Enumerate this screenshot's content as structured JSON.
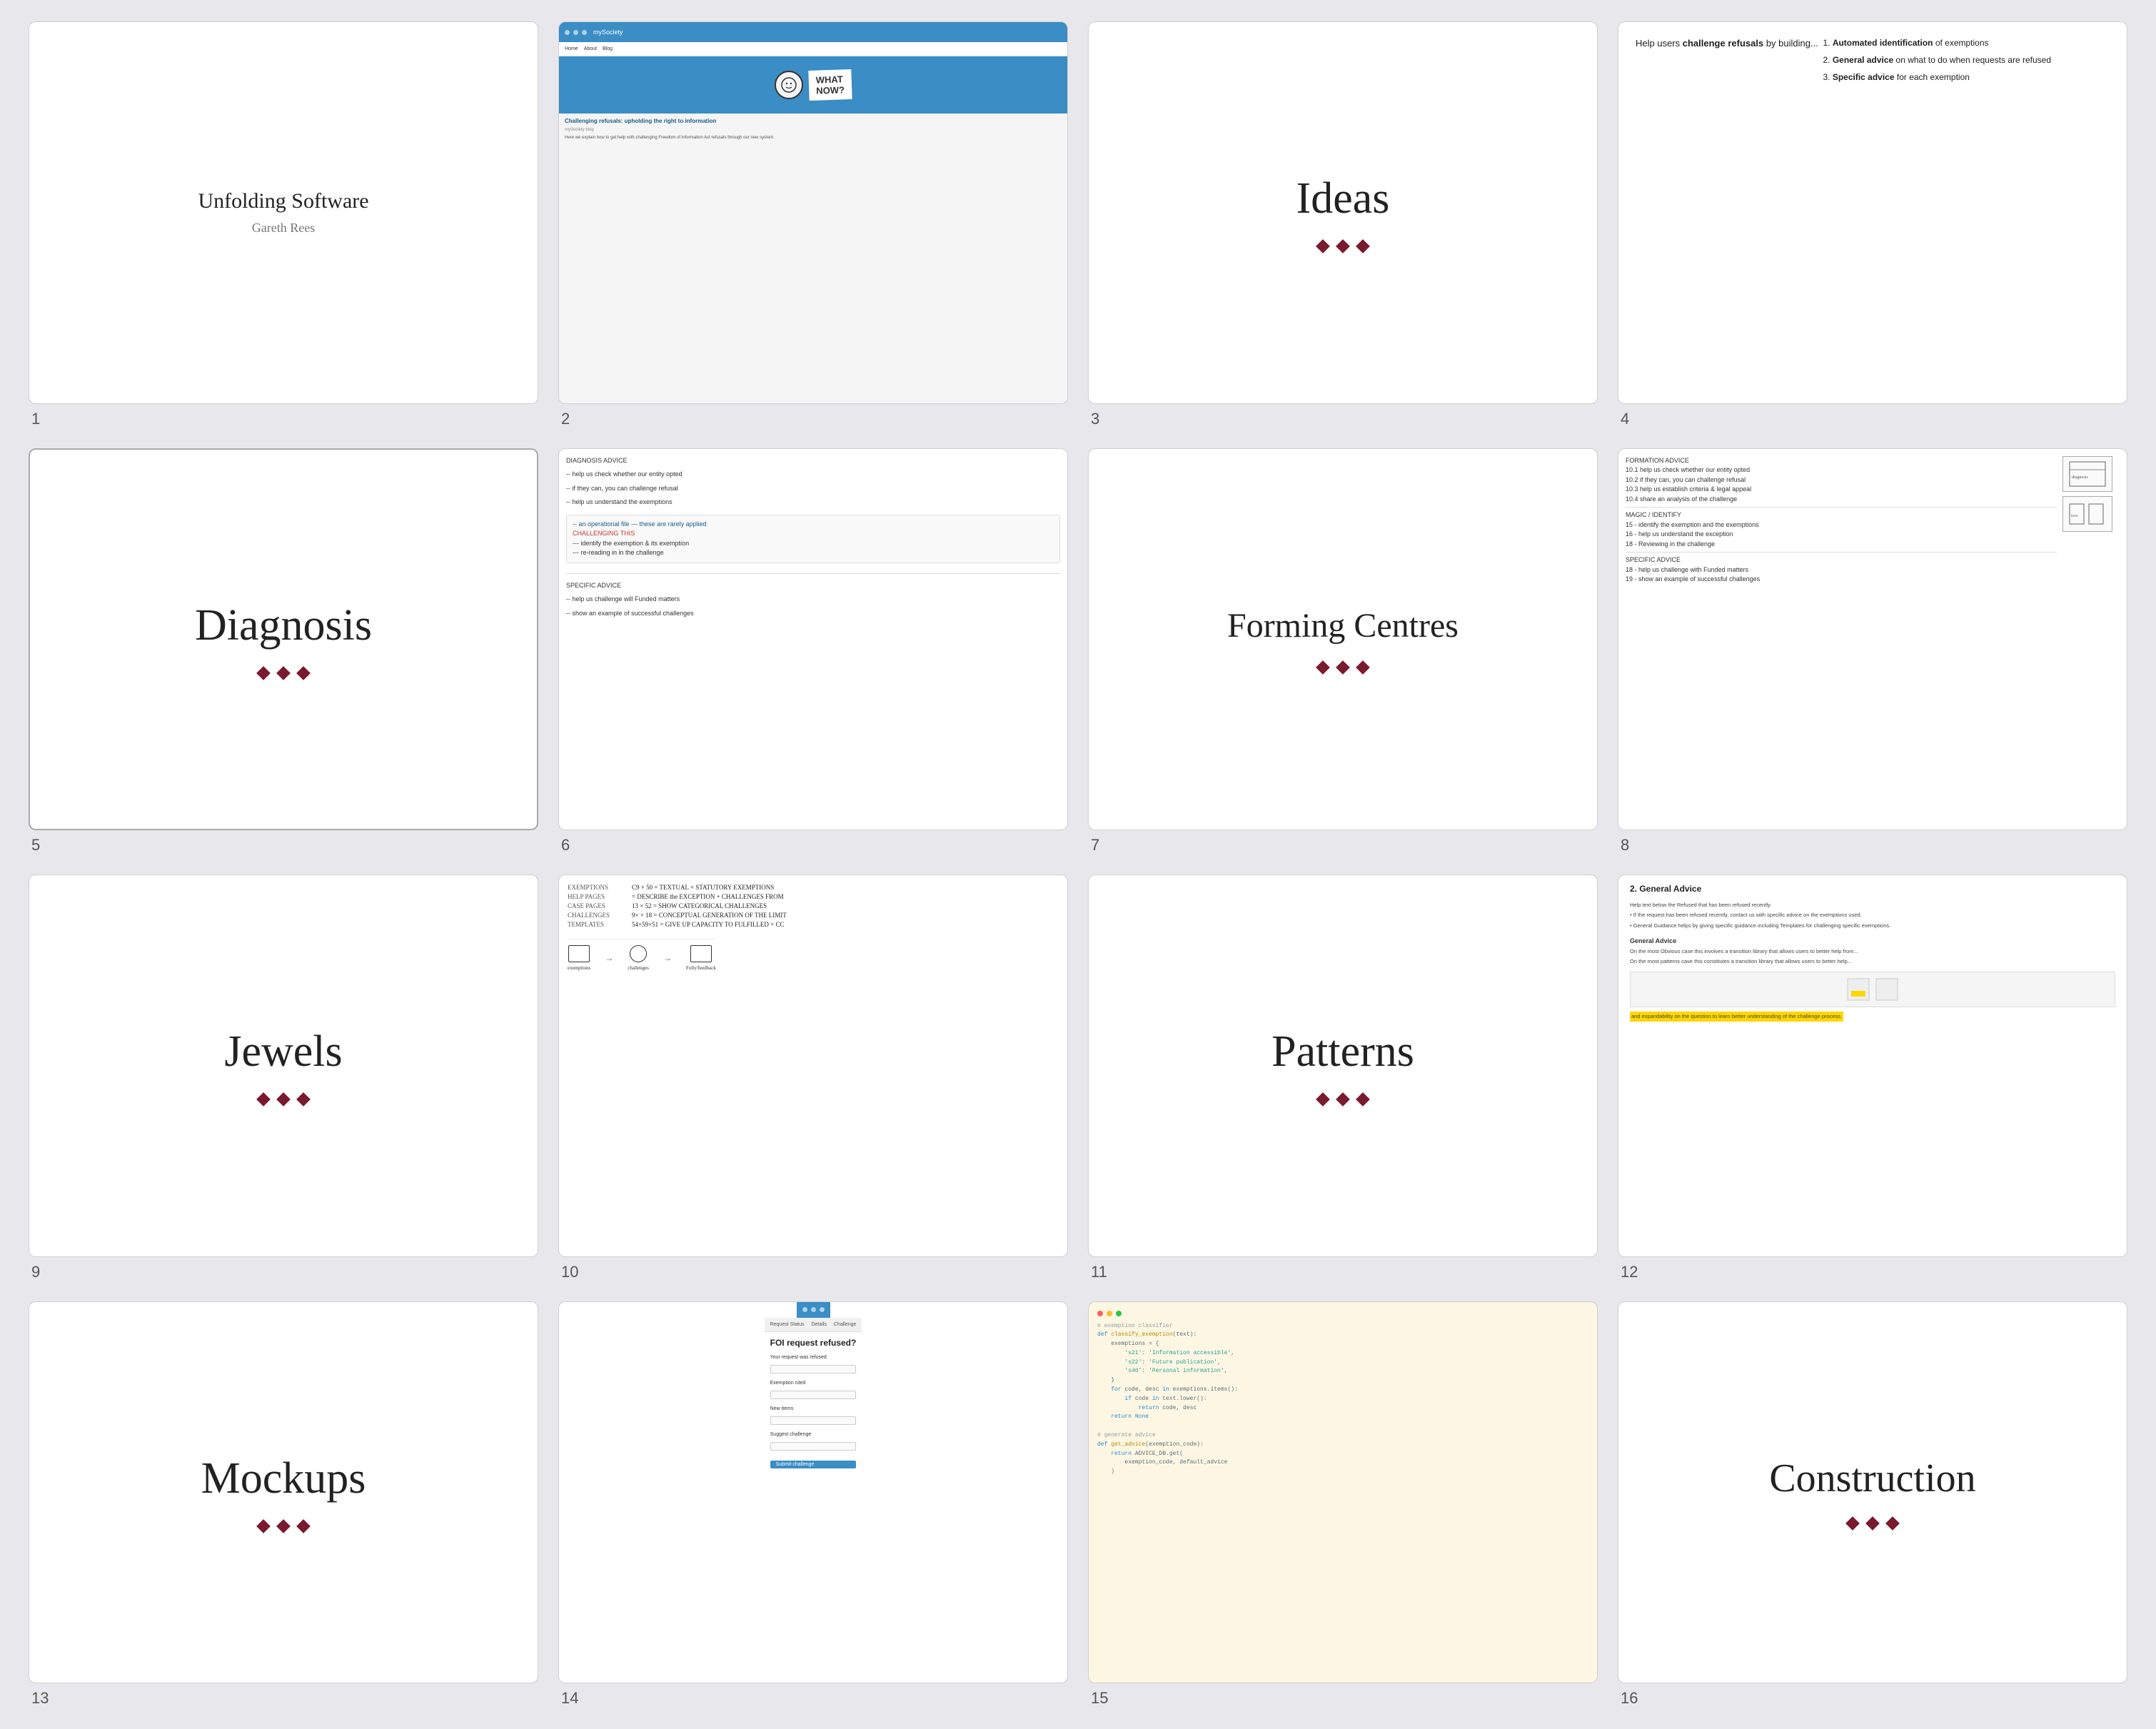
{
  "slides": [
    {
      "id": 1,
      "type": "title",
      "title": "Unfolding Software",
      "subtitle": "Gareth Rees",
      "number": "1"
    },
    {
      "id": 2,
      "type": "web",
      "number": "2",
      "site_name": "mySociety",
      "article_title": "Challenging refusals: upholding the right to information",
      "article_meta": "mySociety blog",
      "article_text": "Here we explain how to get help with challenging Freedom of Information Act refusals through our new system.",
      "what_now_text": "WHAT\nNOW?"
    },
    {
      "id": 3,
      "type": "word",
      "word": "Ideas",
      "number": "3"
    },
    {
      "id": 4,
      "type": "text",
      "number": "4",
      "intro": "Help users challenge refusals by building...",
      "items": [
        {
          "label": "Automated identification",
          "rest": " of exemptions"
        },
        {
          "label": "General advice",
          "rest": " on what to do when requests are refused"
        },
        {
          "label": "Specific advice",
          "rest": " for each exemption"
        }
      ]
    },
    {
      "id": 5,
      "type": "word",
      "word": "Diagnosis",
      "number": "5",
      "active": true
    },
    {
      "id": 6,
      "type": "notes",
      "number": "6"
    },
    {
      "id": 7,
      "type": "word",
      "word": "Forming Centres",
      "number": "7"
    },
    {
      "id": 8,
      "type": "notes_drawing",
      "number": "8"
    },
    {
      "id": 9,
      "type": "word",
      "word": "Jewels",
      "number": "9"
    },
    {
      "id": 10,
      "type": "math_notes",
      "number": "10"
    },
    {
      "id": 11,
      "type": "word",
      "word": "Patterns",
      "number": "11"
    },
    {
      "id": 12,
      "type": "document",
      "number": "12",
      "heading": "2. General Advice"
    },
    {
      "id": 13,
      "type": "word",
      "word": "Mockups",
      "number": "13"
    },
    {
      "id": 14,
      "type": "mockup",
      "number": "14",
      "title": "FOI request refused?"
    },
    {
      "id": 15,
      "type": "code",
      "number": "15"
    },
    {
      "id": 16,
      "type": "word",
      "word": "Construction",
      "number": "16",
      "large": true
    }
  ],
  "diamond_color": "#7a1a2e"
}
